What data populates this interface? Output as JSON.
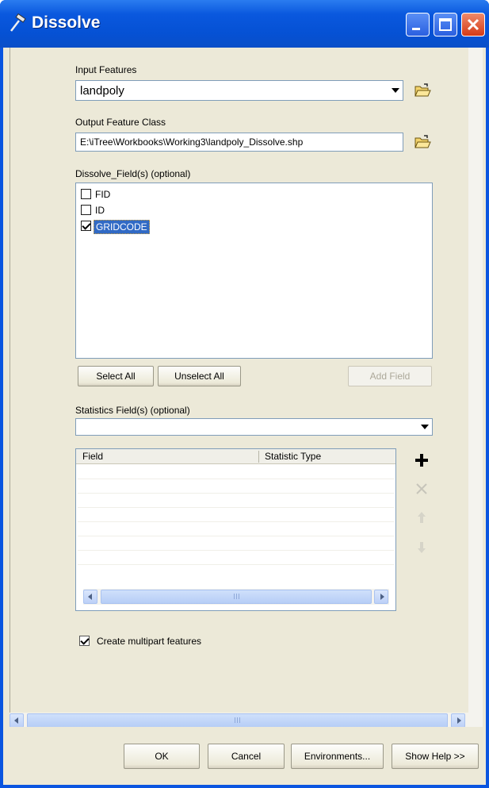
{
  "window": {
    "title": "Dissolve",
    "title_icon": "hammer-icon",
    "controls": [
      "minimize-icon",
      "maximize-icon",
      "close-icon"
    ]
  },
  "input_features": {
    "label": "Input Features",
    "value": "landpoly"
  },
  "output_feature_class": {
    "label": "Output Feature Class",
    "value": "E:\\iTree\\Workbooks\\Working3\\landpoly_Dissolve.shp"
  },
  "dissolve_fields": {
    "label": "Dissolve_Field(s) (optional)",
    "items": [
      {
        "label": "FID",
        "checked": false,
        "selected": false
      },
      {
        "label": "ID",
        "checked": false,
        "selected": false
      },
      {
        "label": "GRIDCODE",
        "checked": true,
        "selected": true
      }
    ],
    "select_all": "Select All",
    "unselect_all": "Unselect All",
    "add_field": "Add Field"
  },
  "statistics_fields": {
    "label": "Statistics Field(s) (optional)",
    "value": "",
    "columns": [
      "Field",
      "Statistic Type"
    ],
    "side_buttons": [
      "add-icon",
      "delete-icon",
      "move-up-icon",
      "move-down-icon"
    ]
  },
  "create_multipart": {
    "label": "Create multipart features",
    "checked": true
  },
  "buttons": {
    "ok": "OK",
    "cancel": "Cancel",
    "environments": "Environments...",
    "show_help": "Show Help >>"
  },
  "colors": {
    "title_bar": "#0a58de",
    "selection": "#316ac5",
    "dialog_bg": "#ece9d8"
  }
}
